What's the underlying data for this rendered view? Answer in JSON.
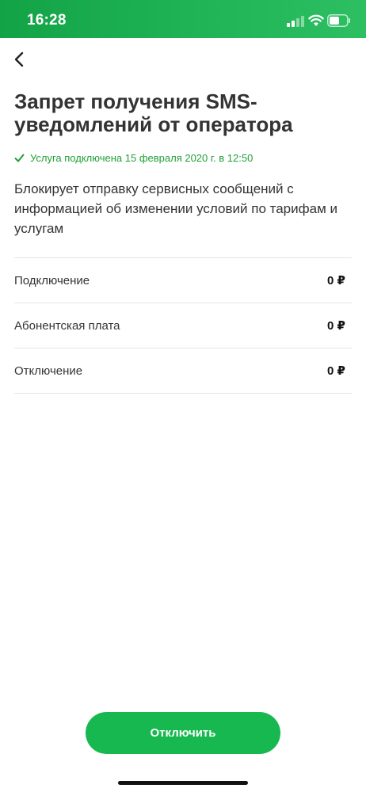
{
  "status_bar": {
    "time": "16:28",
    "background_color": "#1ea651",
    "icons": [
      "signal-icon",
      "wifi-icon",
      "battery-icon"
    ]
  },
  "navigation": {
    "back_icon": "chevron-left-icon"
  },
  "service": {
    "title": "Запрет получения SMS-уведомлений от оператора",
    "status_text": "Услуга подключена 15 февраля 2020 г. в 12:50",
    "status_color": "#21a038",
    "description": "Блокирует отправку сервисных сообщений с информацией об изменении условий по тарифам и услугам"
  },
  "fees": [
    {
      "label": "Подключение",
      "value": "0 ₽"
    },
    {
      "label": "Абонентская плата",
      "value": "0 ₽"
    },
    {
      "label": "Отключение",
      "value": "0 ₽"
    }
  ],
  "action": {
    "disconnect_label": "Отключить",
    "button_color": "#17b84f"
  }
}
